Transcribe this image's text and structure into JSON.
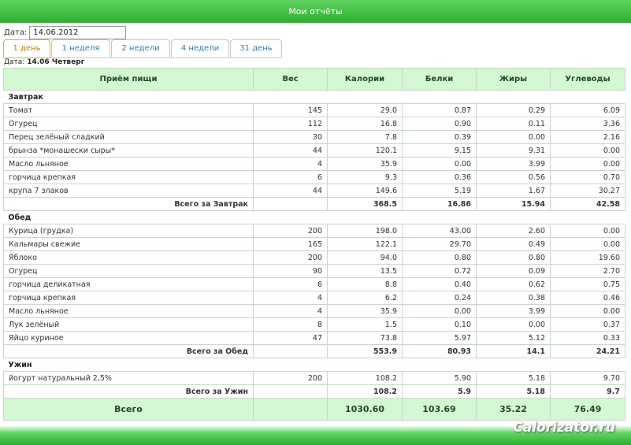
{
  "header": {
    "title": "Мои отчёты"
  },
  "date": {
    "label": "Дата:",
    "value": "14.06.2012"
  },
  "tabs": [
    {
      "label": "1 день",
      "active": true
    },
    {
      "label": "1 неделя",
      "active": false
    },
    {
      "label": "2 недели",
      "active": false
    },
    {
      "label": "4 недели",
      "active": false
    },
    {
      "label": "31 день",
      "active": false
    }
  ],
  "day": {
    "prefix": "Дата:",
    "value": "14.06 Четверг"
  },
  "columns": [
    "Приём пищи",
    "Вес",
    "Калории",
    "Белки",
    "Жиры",
    "Углеводы"
  ],
  "meals": [
    {
      "name": "Завтрак",
      "items": [
        [
          "Томат",
          "145",
          "29.0",
          "0.87",
          "0.29",
          "6.09"
        ],
        [
          "Огурец",
          "112",
          "16.8",
          "0.90",
          "0.11",
          "3.36"
        ],
        [
          "Перец зелёный сладкий",
          "30",
          "7.8",
          "0.39",
          "0.00",
          "2.16"
        ],
        [
          "брынза *монашески сыры*",
          "44",
          "120.1",
          "9.15",
          "9.31",
          "0.00"
        ],
        [
          "Масло льняное",
          "4",
          "35.9",
          "0.00",
          "3.99",
          "0.00"
        ],
        [
          "горчица крепкая",
          "6",
          "9.3",
          "0.36",
          "0.56",
          "0.70"
        ],
        [
          "крупа 7 злаков",
          "44",
          "149.6",
          "5.19",
          "1.67",
          "30.27"
        ]
      ],
      "total": [
        "Всего за Завтрак",
        "",
        "368.5",
        "16.86",
        "15.94",
        "42.58"
      ]
    },
    {
      "name": "Обед",
      "items": [
        [
          "Курица (грудка)",
          "200",
          "198.0",
          "43.00",
          "2.60",
          "0.00"
        ],
        [
          "Кальмары свежие",
          "165",
          "122.1",
          "29.70",
          "0.49",
          "0.00"
        ],
        [
          "Яблоко",
          "200",
          "94.0",
          "0.80",
          "0.80",
          "19.60"
        ],
        [
          "Огурец",
          "90",
          "13.5",
          "0.72",
          "0.09",
          "2.70"
        ],
        [
          "горчица деликатная",
          "6",
          "8.8",
          "0.40",
          "0.62",
          "0.75"
        ],
        [
          "горчица крепкая",
          "4",
          "6.2",
          "0.24",
          "0.38",
          "0.46"
        ],
        [
          "Масло льняное",
          "4",
          "35.9",
          "0.00",
          "3.99",
          "0.00"
        ],
        [
          "Лук зелёный",
          "8",
          "1.5",
          "0.10",
          "0.00",
          "0.37"
        ],
        [
          "Яйцо куриное",
          "47",
          "73.8",
          "5.97",
          "5.12",
          "0.33"
        ]
      ],
      "total": [
        "Всего за Обед",
        "",
        "553.9",
        "80.93",
        "14.1",
        "24.21"
      ]
    },
    {
      "name": "Ужин",
      "items": [
        [
          "йогурт натуральный 2,5%",
          "200",
          "108.2",
          "5.90",
          "5.18",
          "9.70"
        ]
      ],
      "total": [
        "Всего за Ужин",
        "",
        "108.2",
        "5.9",
        "5.18",
        "9.7"
      ]
    }
  ],
  "grand_total": [
    "Всего",
    "",
    "1030.60",
    "103.69",
    "35.22",
    "76.49"
  ],
  "watermark": "Calorizator.ru",
  "colors": {
    "header_green": "#2fae2f",
    "table_header_bg": "#d4f7d4",
    "tab_link": "#2a7fc1",
    "tab_active": "#c08000"
  }
}
